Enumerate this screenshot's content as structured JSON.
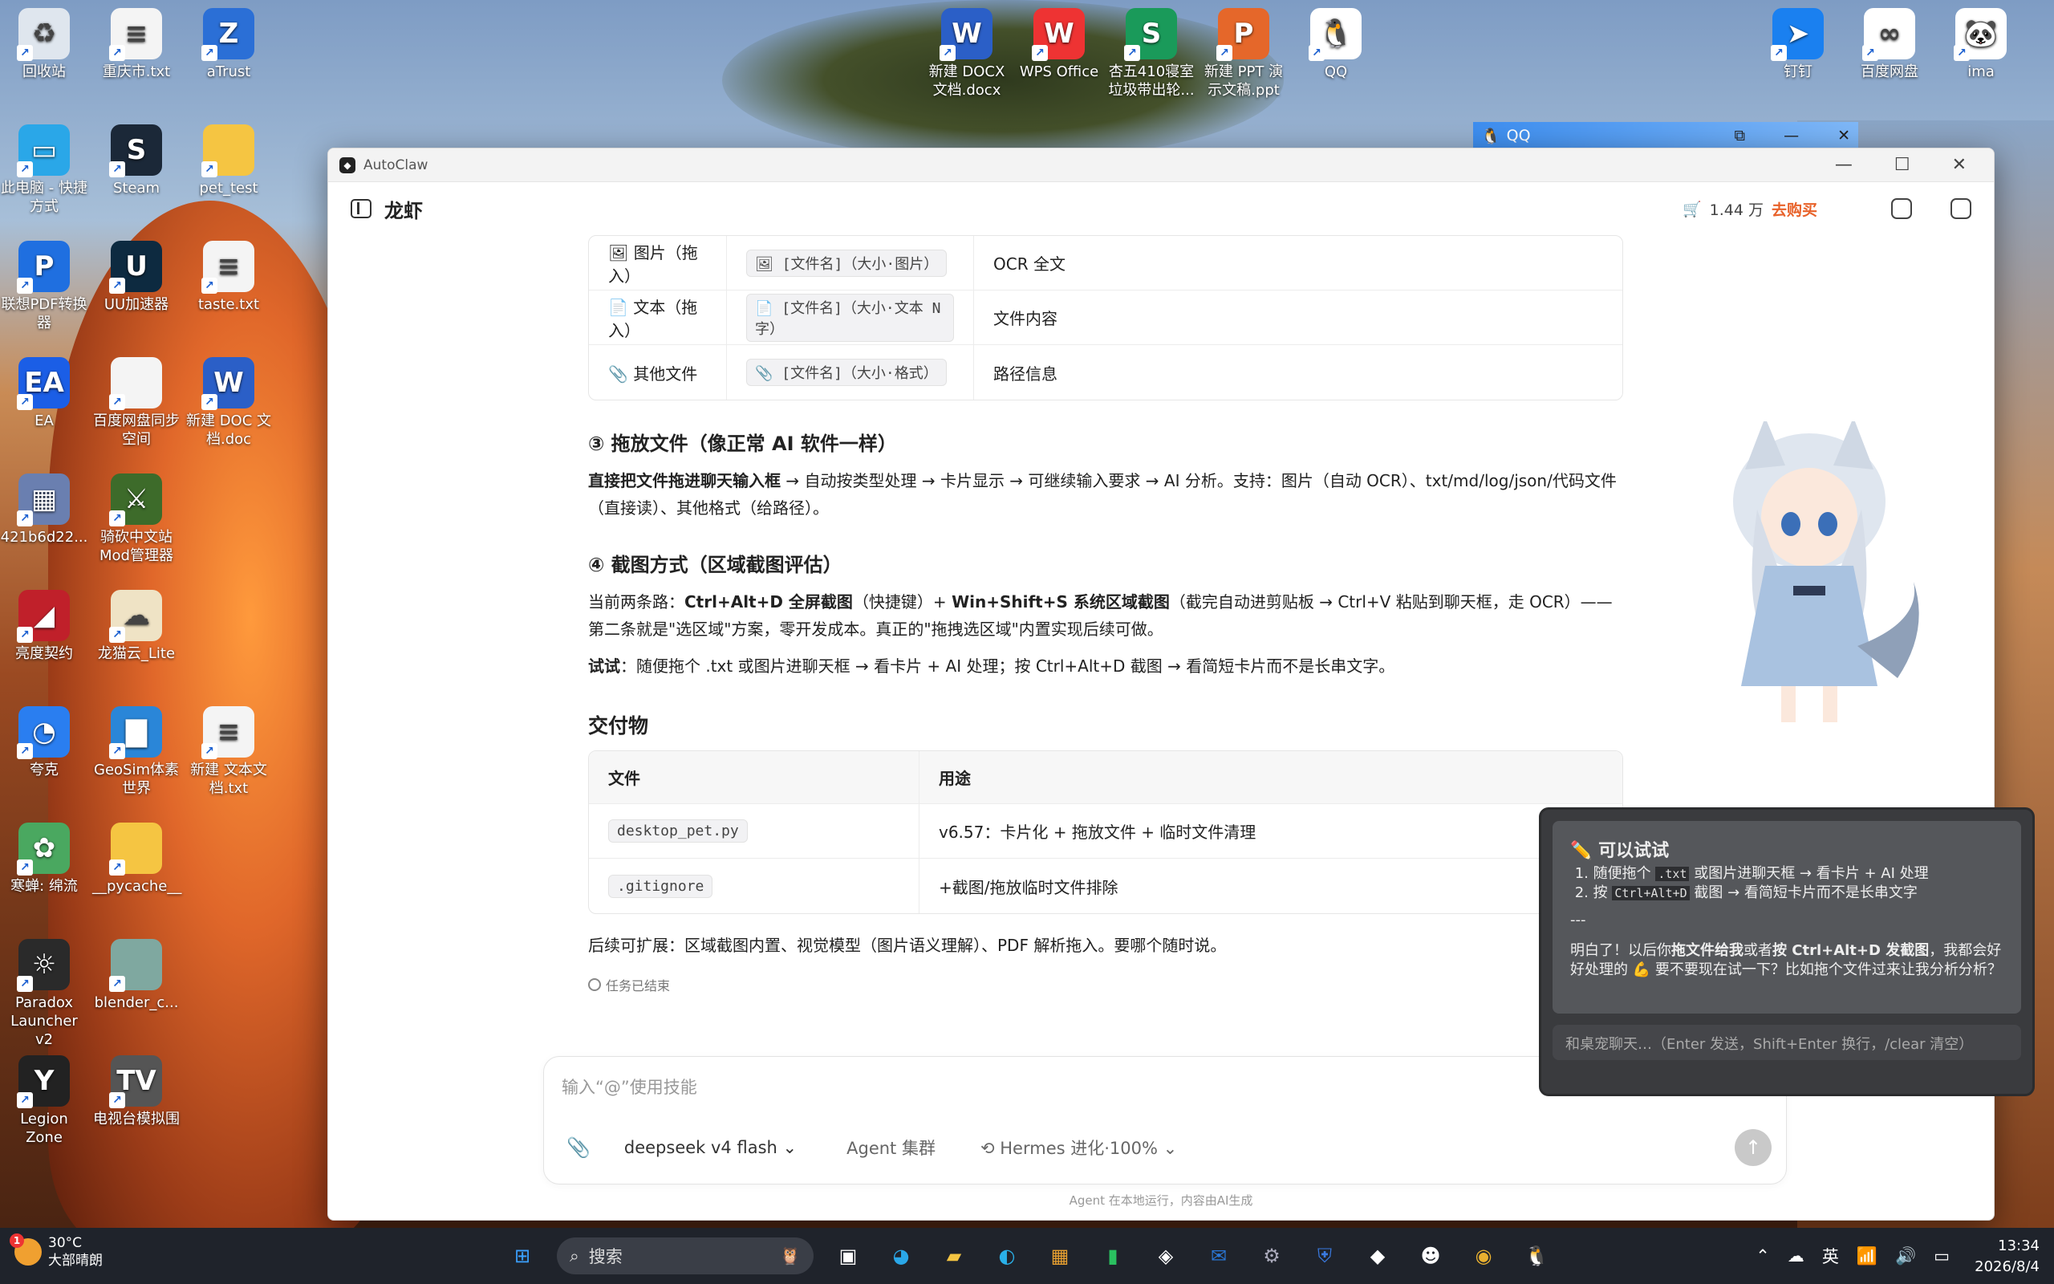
{
  "desktop": {
    "icons": [
      {
        "label": "回收站",
        "icon": "recycle-bin-icon",
        "color": "#dfe6ee",
        "glyph": "♻"
      },
      {
        "label": "重庆市.txt",
        "icon": "text-file-icon",
        "color": "#f4f4f4",
        "glyph": "≡"
      },
      {
        "label": "aTrust",
        "icon": "atrust-icon",
        "color": "#2b6fd6",
        "glyph": "Z"
      },
      {
        "label": "此电脑 - 快捷方式",
        "icon": "computer-icon",
        "color": "#2aa7e8",
        "glyph": "▭"
      },
      {
        "label": "Steam",
        "icon": "steam-icon",
        "color": "#1b2838",
        "glyph": "S"
      },
      {
        "label": "pet_test",
        "icon": "folder-icon",
        "color": "#f5c542",
        "glyph": ""
      },
      {
        "label": "联想PDF转换器",
        "icon": "pdf-converter-icon",
        "color": "#1f6fe0",
        "glyph": "P"
      },
      {
        "label": "UU加速器",
        "icon": "uu-accelerator-icon",
        "color": "#0d2a40",
        "glyph": "U"
      },
      {
        "label": "taste.txt",
        "icon": "text-file-icon",
        "color": "#f4f4f4",
        "glyph": "≡"
      },
      {
        "label": "EA",
        "icon": "ea-icon",
        "color": "#1b5ee6",
        "glyph": "EA"
      },
      {
        "label": "百度网盘同步空间",
        "icon": "file-icon",
        "color": "#f4f4f4",
        "glyph": ""
      },
      {
        "label": "新建 DOC 文档.doc",
        "icon": "word-doc-icon",
        "color": "#2b5fc7",
        "glyph": "W"
      },
      {
        "label": "421b6d22...",
        "icon": "image-file-icon",
        "color": "#6a7fb0",
        "glyph": "▦"
      },
      {
        "label": "骑砍中文站Mod管理器",
        "icon": "mod-manager-icon",
        "color": "#3d6b2a",
        "glyph": "⚔"
      },
      {
        "label": "亮度契约",
        "icon": "brightness-app-icon",
        "color": "#c0202a",
        "glyph": "◢"
      },
      {
        "label": "龙猫云_Lite",
        "icon": "cloud-app-icon",
        "color": "#efe3c5",
        "glyph": "☁"
      },
      {
        "label": "夸克",
        "icon": "quark-icon",
        "color": "#2a7ef0",
        "glyph": "◔"
      },
      {
        "label": "GeoSim体素世界",
        "icon": "geosim-icon",
        "color": "#2a86d8",
        "glyph": "▇"
      },
      {
        "label": "新建 文本文档.txt",
        "icon": "text-file-icon",
        "color": "#f4f4f4",
        "glyph": "≡"
      },
      {
        "label": "寒蝉: 绵流",
        "icon": "anime-game-icon",
        "color": "#4aa860",
        "glyph": "✿"
      },
      {
        "label": "__pycache__",
        "icon": "folder-icon",
        "color": "#f5c542",
        "glyph": ""
      },
      {
        "label": "Paradox Launcher v2",
        "icon": "paradox-icon",
        "color": "#2a2a2a",
        "glyph": "☼"
      },
      {
        "label": "blender_c...",
        "icon": "folder-icon",
        "color": "#7fa8a0",
        "glyph": ""
      },
      {
        "label": "Legion Zone",
        "icon": "legion-icon",
        "color": "#222",
        "glyph": "Y"
      },
      {
        "label": "电视台模拟围",
        "icon": "tv-app-icon",
        "color": "#555",
        "glyph": "TV"
      },
      {
        "label": "新建 DOCX 文档.docx",
        "icon": "word-docx-icon",
        "color": "#2b5fc7",
        "glyph": "W"
      },
      {
        "label": "WPS Office",
        "icon": "wps-icon",
        "color": "#e33",
        "glyph": "W"
      },
      {
        "label": "杏五410寝室垃圾带出轮...",
        "icon": "spreadsheet-icon",
        "color": "#1a9a5a",
        "glyph": "S"
      },
      {
        "label": "新建 PPT 演示文稿.ppt",
        "icon": "ppt-icon",
        "color": "#e5672a",
        "glyph": "P"
      },
      {
        "label": "QQ",
        "icon": "qq-icon",
        "color": "#fff",
        "glyph": "🐧"
      },
      {
        "label": "钉钉",
        "icon": "dingtalk-icon",
        "color": "#1a80f0",
        "glyph": "➤"
      },
      {
        "label": "百度网盘",
        "icon": "baidu-netdisk-icon",
        "color": "#fff",
        "glyph": "∞"
      },
      {
        "label": "ima",
        "icon": "ima-icon",
        "color": "#fff",
        "glyph": "🐼"
      }
    ]
  },
  "qq_bar": {
    "title": "QQ"
  },
  "window": {
    "app_title": "AutoClaw",
    "header_title": "龙虾",
    "credits": "1.44 万",
    "buy": "去购买"
  },
  "tableA": {
    "rows": [
      {
        "type": "🖼 图片（拖入）",
        "card": "🖼 [文件名]（大小·图片）",
        "result": "OCR 全文"
      },
      {
        "type": "📄 文本（拖入）",
        "card": "📄 [文件名]（大小·文本 N 字）",
        "result": "文件内容"
      },
      {
        "type": "📎 其他文件",
        "card": "📎 [文件名]（大小·格式）",
        "result": "路径信息"
      }
    ]
  },
  "sec3": {
    "title": "③ 拖放文件（像正常 AI 软件一样）",
    "bold": "直接把文件拖进聊天输入框",
    "text": " → 自动按类型处理 → 卡片显示 → 可继续输入要求 → AI 分析。支持：图片（自动 OCR）、txt/md/log/json/代码文件（直接读）、其他格式（给路径）。"
  },
  "sec4": {
    "title": "④ 截图方式（区域截图评估）",
    "p1_a": "当前两条路：",
    "p1_b": "Ctrl+Alt+D 全屏截图",
    "p1_c": "（快捷键）+ ",
    "p1_d": "Win+Shift+S 系统区域截图",
    "p1_e": "（截完自动进剪贴板 → Ctrl+V 粘贴到聊天框，走 OCR）——第二条就是\"选区域\"方案，零开发成本。真正的\"拖拽选区域\"内置实现后续可做。",
    "p2_b": "试试",
    "p2_t": "：随便拖个 .txt 或图片进聊天框 → 看卡片 + AI 处理；按 Ctrl+Alt+D 截图 → 看简短卡片而不是长串文字。"
  },
  "deliv": {
    "title": "交付物",
    "headers": [
      "文件",
      "用途"
    ],
    "rows": [
      {
        "file": "desktop_pet.py",
        "use": "v6.57：卡片化 + 拖放文件 + 临时文件清理"
      },
      {
        "file": ".gitignore",
        "use": "+截图/拖放临时文件排除"
      }
    ]
  },
  "followup": "后续可扩展：区域截图内置、视觉模型（图片语义理解）、PDF 解析拖入。要哪个随时说。",
  "status": "任务已结束",
  "input": {
    "placeholder": "输入“@”使用技能",
    "model": "deepseek v4 flash",
    "agent": "Agent 集群",
    "hermes": "Hermes 进化·100%",
    "footer": "Agent 在本地运行，内容由AI生成"
  },
  "pet_chat": {
    "title": "可以试试",
    "li1_a": "随便拖个 ",
    "li1_code": ".txt",
    "li1_b": " 或图片进聊天框 → 看卡片 + AI 处理",
    "li2_a": "按 ",
    "li2_code": "Ctrl+Alt+D",
    "li2_b": " 截图 → 看简短卡片而不是长串文字",
    "sep": "---",
    "msg_a": "明白了！以后你",
    "msg_b": "拖文件给我",
    "msg_c": "或者",
    "msg_d": "按 Ctrl+Alt+D 发截图",
    "msg_e": "，我都会好好处理的 💪 要不要现在试一下？比如拖个文件过来让我分析分析？",
    "placeholder": "和桌宠聊天…（Enter 发送，Shift+Enter 换行，/clear 清空）"
  },
  "taskbar": {
    "temp": "30°C",
    "weather": "大部晴朗",
    "badge": "1",
    "search": "搜索",
    "ime": "英",
    "time": "13:34",
    "date": "2026/8/4"
  }
}
